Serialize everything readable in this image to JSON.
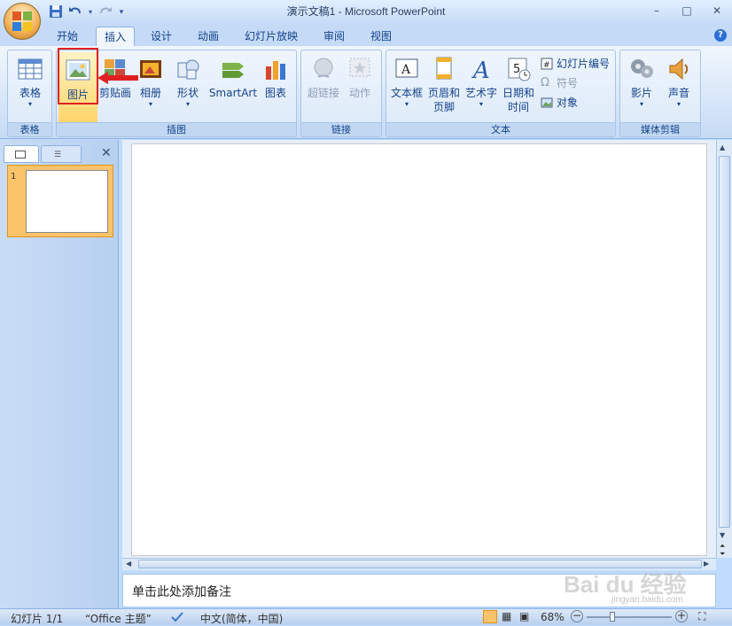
{
  "window": {
    "title": "演示文稿1 - Microsoft PowerPoint",
    "minimize": "–",
    "maximize": "□",
    "close": "✕"
  },
  "qat": {
    "save": "💾",
    "undo": "↶",
    "redo": "↷",
    "more": "≡"
  },
  "tabs": [
    "开始",
    "插入",
    "设计",
    "动画",
    "幻灯片放映",
    "审阅",
    "视图"
  ],
  "active_tab": "插入",
  "help": "?",
  "ribbon": {
    "groups": {
      "table": "表格",
      "illustrations": "插图",
      "links": "链接",
      "text": "文本",
      "media": "媒体剪辑"
    },
    "buttons": {
      "table": "表格",
      "picture": "图片",
      "clipart": "剪贴画",
      "album": "相册",
      "shapes": "形状",
      "smartart": "SmartArt",
      "chart": "图表",
      "hyperlink": "超链接",
      "action": "动作",
      "textbox": "文本框",
      "header_footer_1": "页眉和",
      "header_footer_2": "页脚",
      "wordart": "艺术字",
      "datetime_1": "日期和",
      "datetime_2": "时间",
      "slide_number": "幻灯片编号",
      "symbol": "符号",
      "object": "对象",
      "movie": "影片",
      "sound": "声音"
    },
    "arrow": "▾"
  },
  "left_pane": {
    "close": "✕",
    "slide_number": "1"
  },
  "notes_placeholder": "单击此处添加备注",
  "status": {
    "slide": "幻灯片 1/1",
    "theme": "“Office 主题”",
    "language": "中文(简体，中国)",
    "zoom": "68%"
  },
  "watermark": {
    "main": "Bai du 经验",
    "sub": "jingyan.baidu.com"
  },
  "colors": {
    "accent_red": "#e02020",
    "selected_orange": "#fbc36a",
    "ribbon_text": "#15428b"
  }
}
